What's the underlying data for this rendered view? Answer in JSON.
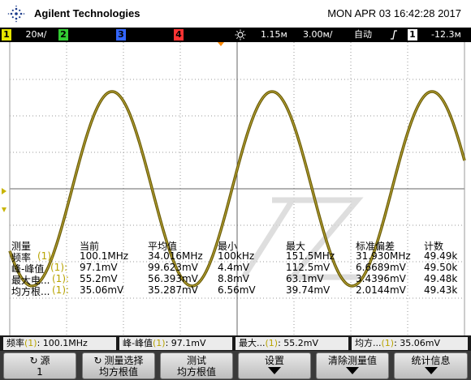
{
  "header": {
    "brand": "Agilent Technologies",
    "datetime": "MON APR 03 16:42:28 2017"
  },
  "status": {
    "ch1_num": "1",
    "ch1_scale": "20ᴍ/",
    "ch2_num": "2",
    "ch3_num": "3",
    "ch4_num": "4",
    "time_pos": "1.15ᴍ",
    "time_scale": "3.00ᴍ/",
    "trigger_mode": "自动",
    "trigger_slope_icon": "rising-edge-icon",
    "trigger_src": "1",
    "trigger_level": "-12.3ᴍ"
  },
  "measurements": {
    "headers": [
      "测量",
      "当前",
      "平均值",
      "最小",
      "最大",
      "标准偏差",
      "计数"
    ],
    "rows": [
      {
        "name": "频率",
        "src": "(1):",
        "cur": "100.1MHz",
        "avg": "34.016MHz",
        "min": "100kHz",
        "max": "151.5MHz",
        "std": "31.930MHz",
        "cnt": "49.49k"
      },
      {
        "name": "峰-峰值",
        "src": "(1):",
        "cur": "97.1mV",
        "avg": "99.623mV",
        "min": "4.4mV",
        "max": "112.5mV",
        "std": "6.6689mV",
        "cnt": "49.50k"
      },
      {
        "name": "最大电...",
        "src": "(1):",
        "cur": "55.2mV",
        "avg": "56.393mV",
        "min": "8.8mV",
        "max": "63.1mV",
        "std": "3.4396mV",
        "cnt": "49.48k"
      },
      {
        "name": "均方根...",
        "src": "(1):",
        "cur": "35.06mV",
        "avg": "35.287mV",
        "min": "6.56mV",
        "max": "39.74mV",
        "std": "2.0144mV",
        "cnt": "49.43k"
      }
    ]
  },
  "quickbar": [
    {
      "label": "频率",
      "src": "(1)",
      "value": ": 100.1MHz"
    },
    {
      "label": "峰-峰值",
      "src": "(1)",
      "value": ": 97.1mV"
    },
    {
      "label": "最大...",
      "src": "(1)",
      "value": ": 55.2mV"
    },
    {
      "label": "均方...",
      "src": "(1)",
      "value": ": 35.06mV"
    }
  ],
  "softkeys": {
    "source_label": "源",
    "source_value": "1",
    "select_label": "测量选择",
    "select_value": "均方根值",
    "test_label": "测试",
    "test_value": "均方根值",
    "settings_label": "设置",
    "clear_label": "清除测量值",
    "stats_label": "统计信息"
  },
  "colors": {
    "trace": "#7a6a0a",
    "ch1": "#e6e600",
    "grid": "#b0b0b0"
  }
}
